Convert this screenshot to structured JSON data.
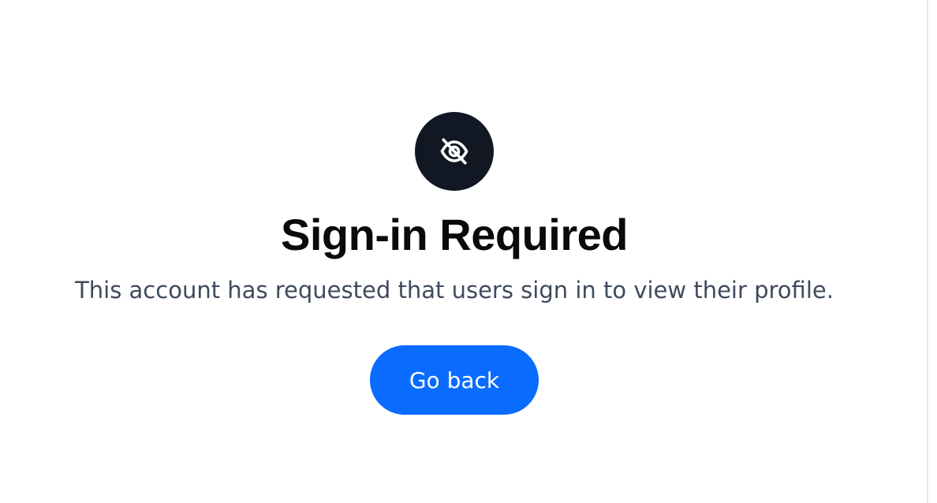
{
  "notice": {
    "icon": "eye-slash-icon",
    "title": "Sign-in Required",
    "message": "This account has requested that users sign in to view their profile.",
    "go_back_label": "Go back"
  },
  "colors": {
    "icon_background": "#111823",
    "title": "#0a0a0a",
    "message": "#3f4a5c",
    "button_background": "#0a6cff",
    "button_text": "#ffffff"
  }
}
